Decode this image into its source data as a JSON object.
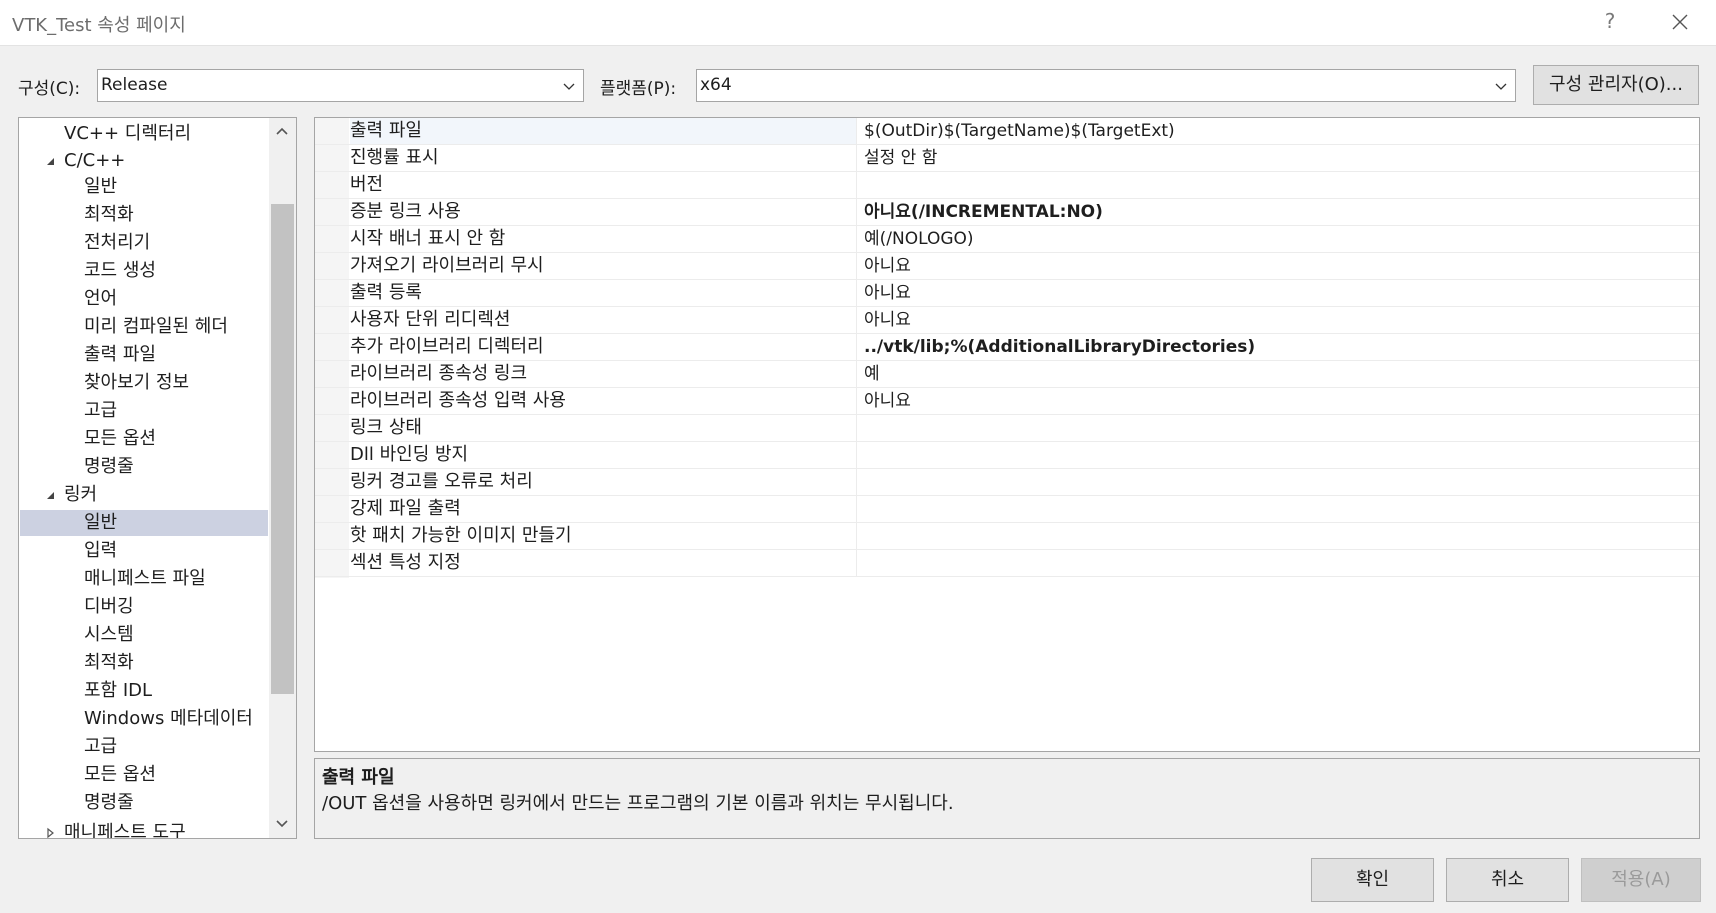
{
  "window": {
    "title": "VTK_Test 속성 페이지",
    "help_label": "?"
  },
  "toolbar": {
    "config_label": "구성(C):",
    "config_value": "Release",
    "platform_label": "플랫폼(P):",
    "platform_value": "x64",
    "config_manager_label": "구성 관리자(O)..."
  },
  "tree": {
    "items": [
      {
        "label": "VC++ 디렉터리"
      },
      {
        "label": "C/C++"
      },
      {
        "label": "일반"
      },
      {
        "label": "최적화"
      },
      {
        "label": "전처리기"
      },
      {
        "label": "코드 생성"
      },
      {
        "label": "언어"
      },
      {
        "label": "미리 컴파일된 헤더"
      },
      {
        "label": "출력 파일"
      },
      {
        "label": "찾아보기 정보"
      },
      {
        "label": "고급"
      },
      {
        "label": "모든 옵션"
      },
      {
        "label": "명령줄"
      },
      {
        "label": "링커"
      },
      {
        "label": "일반"
      },
      {
        "label": "입력"
      },
      {
        "label": "매니페스트 파일"
      },
      {
        "label": "디버깅"
      },
      {
        "label": "시스템"
      },
      {
        "label": "최적화"
      },
      {
        "label": "포함 IDL"
      },
      {
        "label": "Windows 메타데이터"
      },
      {
        "label": "고급"
      },
      {
        "label": "모든 옵션"
      },
      {
        "label": "명령줄"
      },
      {
        "label": "매니페스트 도구"
      }
    ]
  },
  "properties": [
    {
      "name": "출력 파일",
      "value": "$(OutDir)$(TargetName)$(TargetExt)"
    },
    {
      "name": "진행률 표시",
      "value": "설정 안 함"
    },
    {
      "name": "버전",
      "value": ""
    },
    {
      "name": "증분 링크 사용",
      "value": "아니요(/INCREMENTAL:NO)"
    },
    {
      "name": "시작 배너 표시 안 함",
      "value": "예(/NOLOGO)"
    },
    {
      "name": "가져오기 라이브러리 무시",
      "value": "아니요"
    },
    {
      "name": "출력 등록",
      "value": "아니요"
    },
    {
      "name": "사용자 단위 리디렉션",
      "value": "아니요"
    },
    {
      "name": "추가 라이브러리 디렉터리",
      "value": "../vtk/lib;%(AdditionalLibraryDirectories)"
    },
    {
      "name": "라이브러리 종속성 링크",
      "value": "예"
    },
    {
      "name": "라이브러리 종속성 입력 사용",
      "value": "아니요"
    },
    {
      "name": "링크 상태",
      "value": ""
    },
    {
      "name": "Dll 바인딩 방지",
      "value": ""
    },
    {
      "name": "링커 경고를 오류로 처리",
      "value": ""
    },
    {
      "name": "강제 파일 출력",
      "value": ""
    },
    {
      "name": "핫 패치 가능한 이미지 만들기",
      "value": ""
    },
    {
      "name": "섹션 특성 지정",
      "value": ""
    }
  ],
  "description": {
    "title": "출력 파일",
    "text": "/OUT 옵션을 사용하면 링커에서 만드는 프로그램의 기본 이름과 위치는 무시됩니다."
  },
  "buttons": {
    "ok": "확인",
    "cancel": "취소",
    "apply": "적용(A)"
  },
  "colors": {
    "selection": "#ccd1e1",
    "window_bg": "#f0f0f0"
  }
}
